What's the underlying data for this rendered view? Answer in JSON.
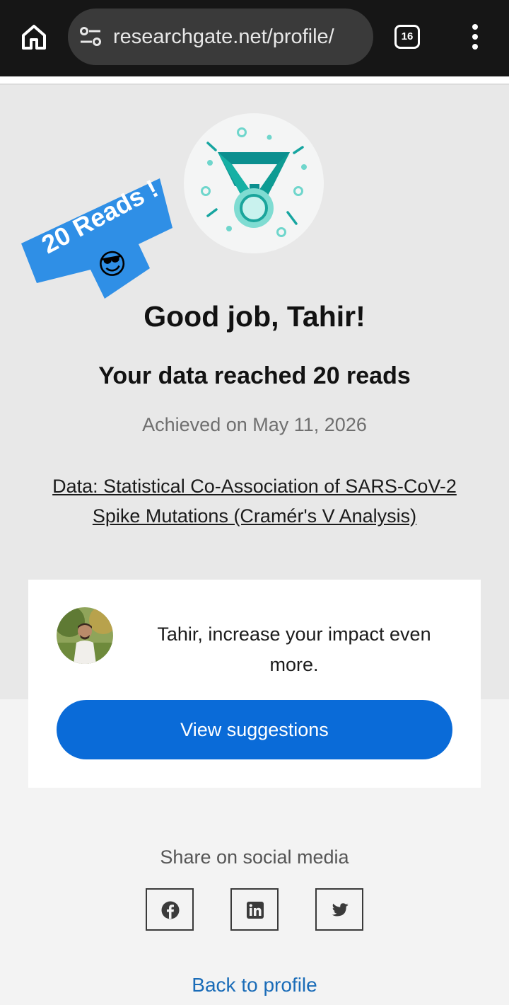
{
  "browser": {
    "url": "researchgate.net/profile/",
    "tab_count": "16",
    "icons": {
      "home": "home-icon",
      "site_info": "tune-icon",
      "tabs": "tab-switcher-icon",
      "menu": "more-vert-icon"
    }
  },
  "achievement": {
    "sticker_text": "20 Reads !",
    "sticker_emoji": "😎",
    "headline": "Good job, Tahir!",
    "subheadline": "Your data reached 20 reads",
    "achieved_on": "Achieved on May 11, 2026",
    "publication_link": "Data: Statistical Co-Association of SARS-CoV-2 Spike Mutations (Cramér's V Analysis)"
  },
  "suggestion_card": {
    "message": "Tahir, increase your impact even more.",
    "button_label": "View suggestions"
  },
  "share": {
    "label": "Share on social media",
    "networks": [
      "facebook",
      "linkedin",
      "twitter"
    ]
  },
  "footer": {
    "back_link": "Back to profile"
  },
  "colors": {
    "primary_button": "#0a6bd8",
    "sticker_blue": "#2f8fe6",
    "medal_teal": "#0b8f8f",
    "medal_light": "#6fd6cc"
  }
}
